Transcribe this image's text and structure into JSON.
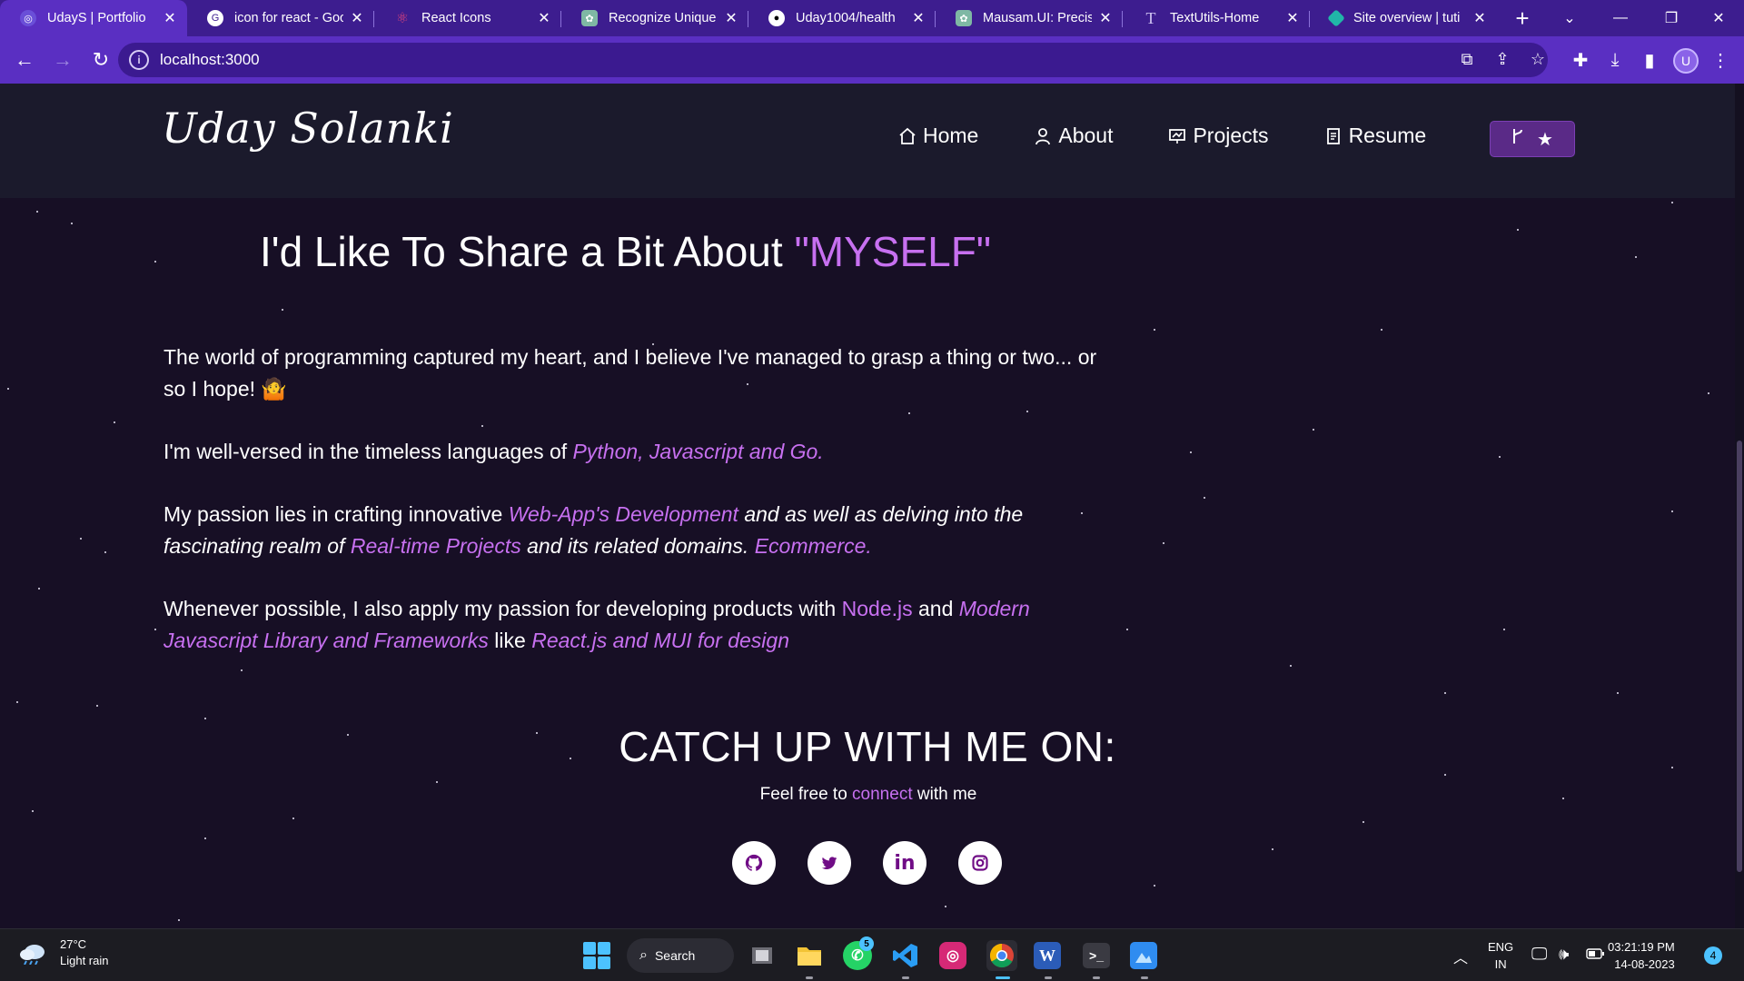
{
  "browser": {
    "tabs": [
      {
        "title": "UdayS | Portfolio",
        "icon": "portfolio-favicon",
        "active": true
      },
      {
        "title": "icon for react - Goo",
        "icon": "google-favicon",
        "active": false
      },
      {
        "title": "React Icons",
        "icon": "react-favicon",
        "active": false
      },
      {
        "title": "Recognize Unique",
        "icon": "chatgpt-favicon",
        "active": false
      },
      {
        "title": "Uday1004/health",
        "icon": "github-favicon",
        "active": false
      },
      {
        "title": "Mausam.UI: Precise",
        "icon": "chatgpt-favicon",
        "active": false
      },
      {
        "title": "TextUtils-Home",
        "icon": "text-favicon",
        "active": false
      },
      {
        "title": "Site overview | tuti",
        "icon": "netlify-favicon",
        "active": false
      }
    ],
    "new_tab": "+",
    "url": "localhost:3000",
    "profile_initial": "U"
  },
  "site": {
    "logo": "Uday Solanki",
    "nav": [
      {
        "label": "Home",
        "icon": "home-icon"
      },
      {
        "label": "About",
        "icon": "user-icon"
      },
      {
        "label": "Projects",
        "icon": "projects-icon"
      },
      {
        "label": "Resume",
        "icon": "document-icon"
      }
    ],
    "github_button": {
      "icons": [
        "fork-icon",
        "star-icon"
      ]
    }
  },
  "about": {
    "heading_pre": "I'd Like To Share a Bit About ",
    "heading_accent": "\"MYSELF\"",
    "p1_text": "The world of programming captured my heart, and I believe I've managed to grasp a thing or two... or so I hope! ",
    "p1_emoji": "🤷",
    "p2_text": "I'm well-versed in the timeless languages of ",
    "p2_hl": "Python, Javascript and Go.",
    "p3_a": "My passion lies in crafting innovative ",
    "p3_hl1": "Web-App's Development",
    "p3_b": " and as well as delving into the fascinating realm of ",
    "p3_hl2": "Real-time Projects",
    "p3_c": " and its related domains. ",
    "p3_hl3": "Ecommerce.",
    "p4_a": "Whenever possible, I also apply my passion for developing products with ",
    "p4_hl1": "Node.js",
    "p4_b": " and ",
    "p4_hl2": "Modern Javascript Library and Frameworks",
    "p4_c": "  like ",
    "p4_hl3": "React.js and MUI for design"
  },
  "social": {
    "title": "CATCH UP WITH ME ON:",
    "feel_pre": "Feel free to ",
    "feel_link": "connect",
    "feel_post": " with me",
    "links": [
      "github-icon",
      "twitter-icon",
      "linkedin-icon",
      "instagram-icon"
    ]
  },
  "taskbar": {
    "temp": "27°C",
    "weather": "Light rain",
    "search": "Search",
    "whatsapp_badge": "5",
    "lang_1": "ENG",
    "lang_2": "IN",
    "time": "03:21:19 PM",
    "date": "14-08-2023",
    "notifications": "4"
  },
  "colors": {
    "accent": "#c770f0",
    "page_bg": "#170f25",
    "browser_frame": "#5a2fc2"
  }
}
